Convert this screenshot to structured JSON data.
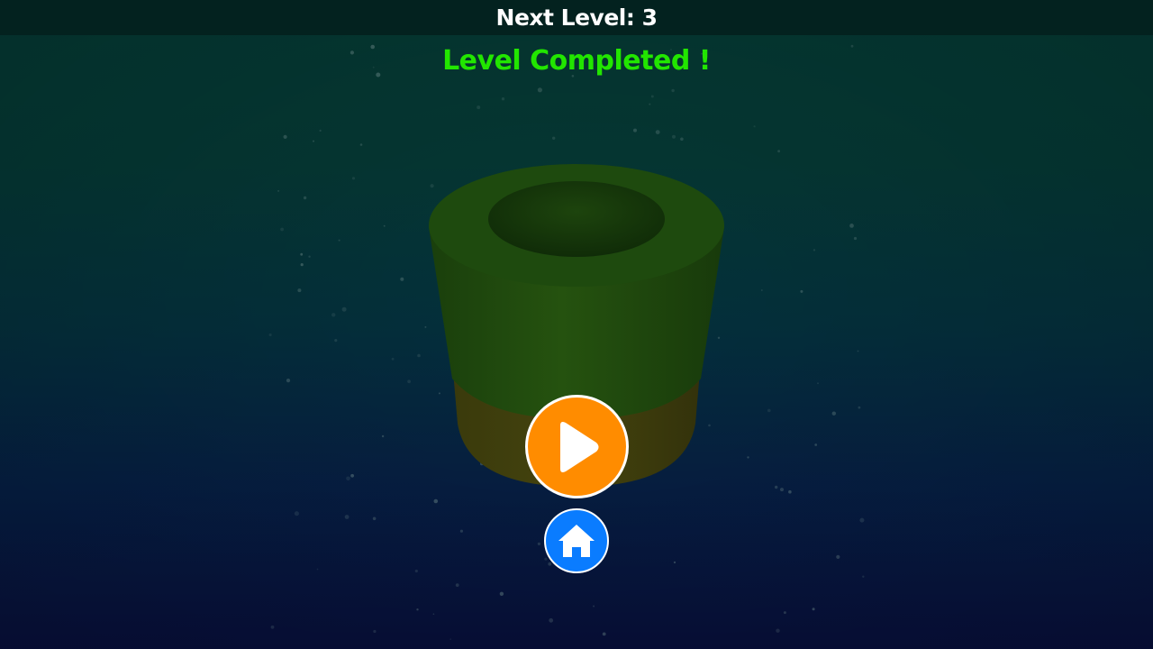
{
  "header": {
    "next_level_text": "Next Level: 3"
  },
  "status": {
    "message": "Level Completed !",
    "color": "#22e600"
  },
  "buttons": {
    "play": {
      "icon": "play-icon",
      "color": "#ff8c00"
    },
    "home": {
      "icon": "home-icon",
      "color": "#0a7cff"
    }
  },
  "scene": {
    "object": "cylinder-tube",
    "body_color": "#1f4a0f",
    "base_color": "#3c3c0c"
  }
}
